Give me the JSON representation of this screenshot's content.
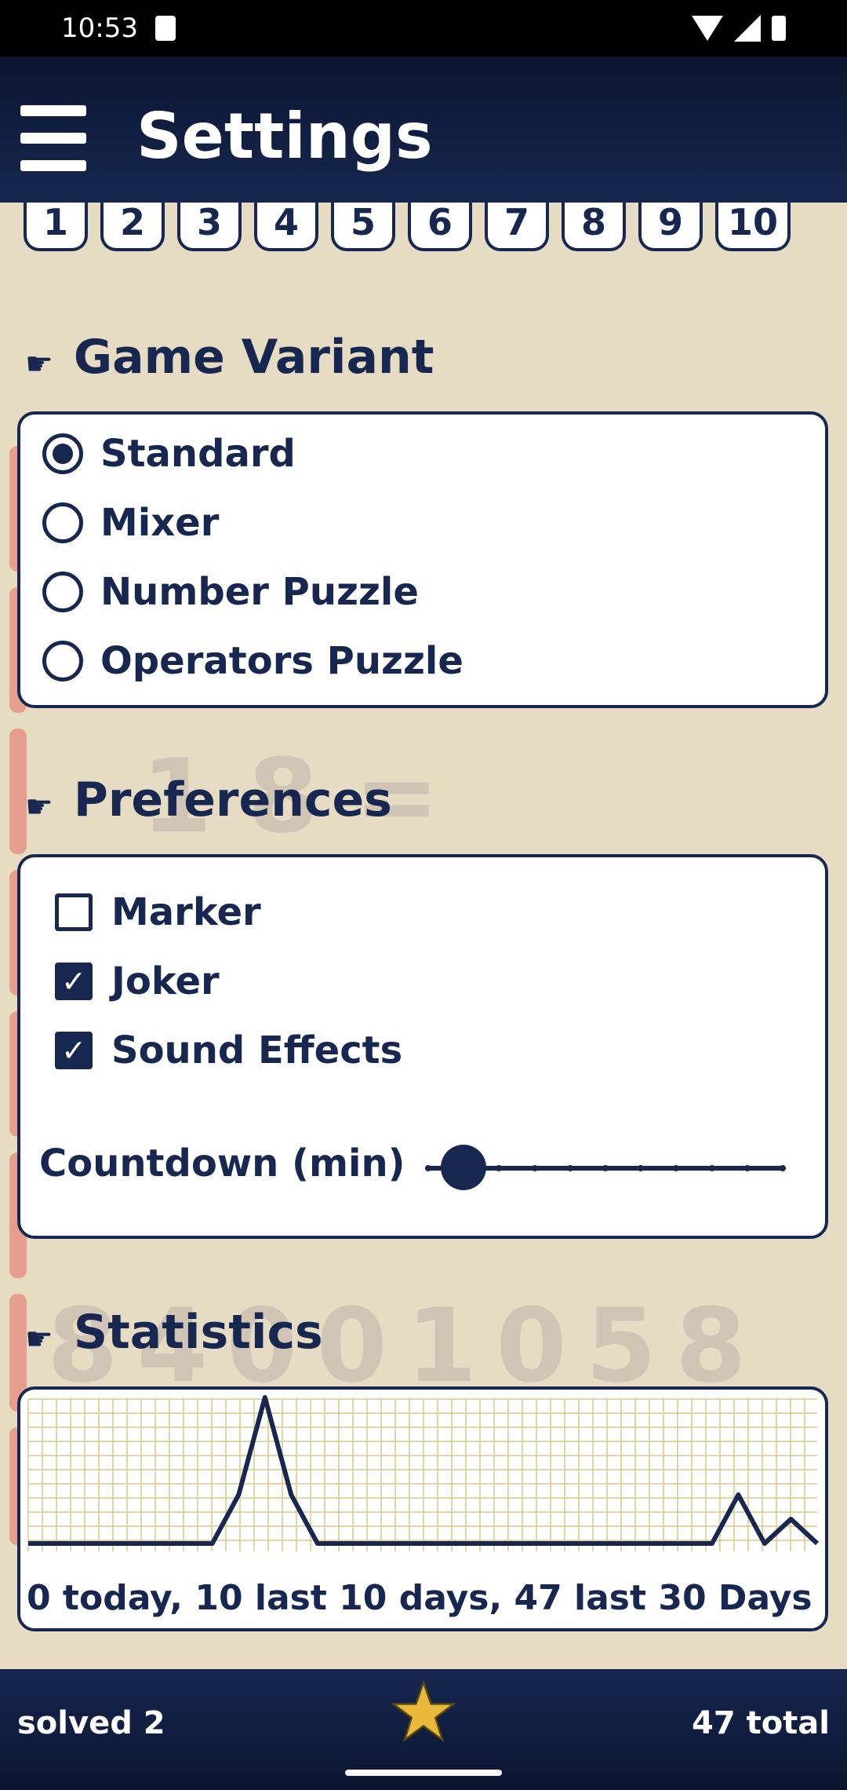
{
  "status_bar": {
    "time": "10:53"
  },
  "app_bar": {
    "title": "Settings"
  },
  "number_chips": [
    "1",
    "2",
    "3",
    "4",
    "5",
    "6",
    "7",
    "8",
    "9",
    "10"
  ],
  "game_variant": {
    "title": "Game Variant",
    "options": [
      {
        "label": "Standard",
        "selected": true
      },
      {
        "label": "Mixer",
        "selected": false
      },
      {
        "label": "Number Puzzle",
        "selected": false
      },
      {
        "label": "Operators Puzzle",
        "selected": false
      }
    ]
  },
  "preferences": {
    "title": "Preferences",
    "items": [
      {
        "label": "Marker",
        "checked": false
      },
      {
        "label": "Joker",
        "checked": true
      },
      {
        "label": "Sound Effects",
        "checked": true
      }
    ],
    "countdown_label": "Countdown (min)",
    "countdown_steps": 11,
    "countdown_index": 1
  },
  "statistics": {
    "title": "Statistics",
    "caption": "0 today, 10 last 10 days, 47 last 30 Days"
  },
  "chart_data": {
    "type": "line",
    "x": [
      1,
      2,
      3,
      4,
      5,
      6,
      7,
      8,
      9,
      10,
      11,
      12,
      13,
      14,
      15,
      16,
      17,
      18,
      19,
      20,
      21,
      22,
      23,
      24,
      25,
      26,
      27,
      28,
      29,
      30,
      31
    ],
    "values": [
      0,
      0,
      0,
      0,
      0,
      0,
      0,
      0,
      2,
      6,
      2,
      0,
      0,
      0,
      0,
      0,
      0,
      0,
      0,
      0,
      0,
      0,
      0,
      0,
      0,
      0,
      0,
      2,
      0,
      1,
      0
    ],
    "ylim": [
      0,
      6
    ],
    "grid": true
  },
  "bottom_bar": {
    "solved": "solved 2",
    "total": "47 total"
  },
  "colors": {
    "navy": "#17274f",
    "background": "#e6dcc4",
    "star": "#e9b93b",
    "grid": "#d9c98a"
  }
}
